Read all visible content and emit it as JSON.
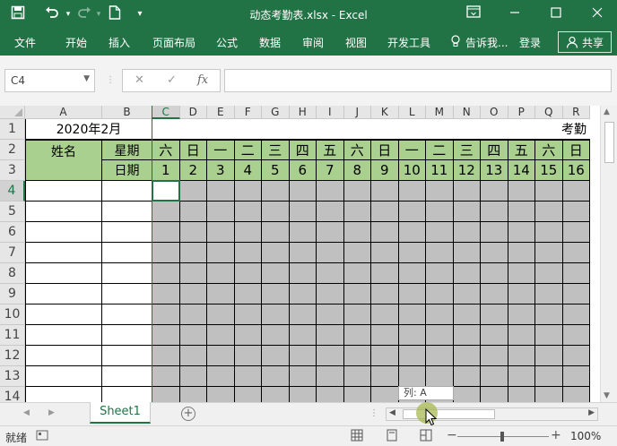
{
  "window": {
    "title": "动态考勤表.xlsx - Excel",
    "icons": [
      "save-icon",
      "undo-icon",
      "redo-icon",
      "new-document-icon",
      "quick-access-dropdown-icon",
      "ribbon-display-options-icon",
      "minimize-icon",
      "maximize-icon",
      "close-icon"
    ]
  },
  "ribbon": {
    "tabs": [
      "文件",
      "开始",
      "插入",
      "页面布局",
      "公式",
      "数据",
      "审阅",
      "视图",
      "开发工具"
    ],
    "tell_me": "告诉我...",
    "login": "登录",
    "share": "共享"
  },
  "formula_bar": {
    "name_box": "C4",
    "formula": "",
    "fx": "fx",
    "cancel": "✕",
    "enter": "✓"
  },
  "sheet": {
    "column_letters": [
      "A",
      "B",
      "C",
      "D",
      "E",
      "F",
      "G",
      "H",
      "I",
      "J",
      "K",
      "L",
      "M",
      "N",
      "O",
      "P",
      "Q",
      "R"
    ],
    "row_numbers": [
      "1",
      "2",
      "3",
      "4",
      "5",
      "6",
      "7",
      "8",
      "9",
      "10",
      "11",
      "12",
      "13",
      "14"
    ],
    "a1": "2020年2月",
    "title_right": "考勤",
    "header_name": "姓名",
    "header_weekday": "星期",
    "header_date": "日期",
    "weekdays": [
      "六",
      "日",
      "一",
      "二",
      "三",
      "四",
      "五",
      "六",
      "日",
      "一",
      "二",
      "三",
      "四",
      "五",
      "六",
      "日"
    ],
    "dates": [
      "1",
      "2",
      "3",
      "4",
      "5",
      "6",
      "7",
      "8",
      "9",
      "10",
      "11",
      "12",
      "13",
      "14",
      "15",
      "16"
    ],
    "selected_cell": "C4",
    "header_fill": "#a9d08e",
    "grid_fill": "#c0c0c0"
  },
  "tabs": {
    "sheet_name": "Sheet1",
    "tooltip": "列: A"
  },
  "status": {
    "ready": "就绪",
    "zoom": "100%",
    "minus": "−",
    "plus": "+"
  }
}
